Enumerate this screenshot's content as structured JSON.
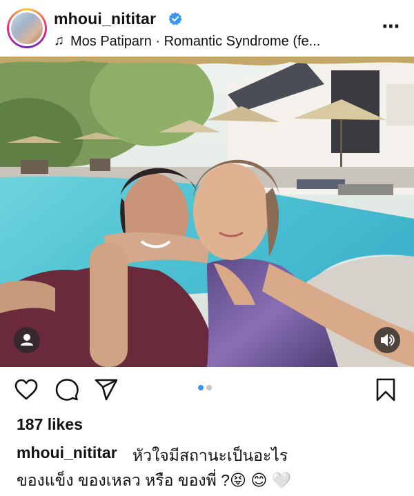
{
  "header": {
    "username": "mhoui_nititar",
    "music_note": "♫",
    "music": "Mos Patiparn · Romantic Syndrome (fe...",
    "more": "⋯"
  },
  "post": {
    "likes": "187 likes",
    "caption_user": "mhoui_nititar",
    "caption_line1": "หัวใจมีสถานะเป็นอะไร",
    "caption_line2": "ของแข็ง ของเหลว หรือ ของพี่ ?😝 😊 🤍",
    "carousel_total": 2,
    "carousel_active": 1
  },
  "colors": {
    "verified": "#3897f0",
    "active_dot": "#3897f0",
    "inactive_dot": "#c7c7c7",
    "text": "#111111"
  },
  "icons": {
    "like": "heart-icon",
    "comment": "comment-icon",
    "share": "send-icon",
    "save": "bookmark-icon",
    "user_tag": "user-icon",
    "sound": "speaker-icon"
  }
}
